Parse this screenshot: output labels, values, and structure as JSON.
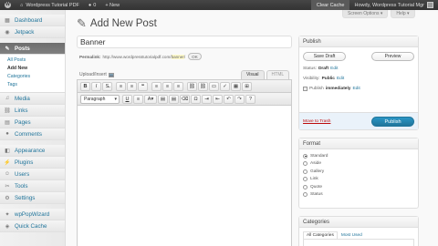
{
  "adminbar": {
    "site_name": "Wordpress Tutorial PDF",
    "comments_count": "0",
    "new_label": "+ New",
    "clear_cache": "Clear Cache",
    "howdy": "Howdy, Wordpress Tutorial Mgr"
  },
  "screen": {
    "options": "Screen Options ▾",
    "help": "Help ▾"
  },
  "menu": {
    "dashboard": "Dashboard",
    "jetpack": "Jetpack",
    "posts": "Posts",
    "posts_sub": [
      "All Posts",
      "Add New",
      "Categories",
      "Tags"
    ],
    "media": "Media",
    "links": "Links",
    "pages": "Pages",
    "comments": "Comments",
    "appearance": "Appearance",
    "plugins": "Plugins",
    "users": "Users",
    "tools": "Tools",
    "settings": "Settings",
    "wppopwizard": "wpPopWizard",
    "quick_cache": "Quick Cache"
  },
  "page": {
    "title": "Add New Post"
  },
  "post": {
    "title_value": "Banner",
    "permalink_label": "Permalink:",
    "permalink_base": "http://www.wordpresstutorialpdf.com/",
    "permalink_slug": "banner",
    "ok_label": "OK"
  },
  "editor": {
    "upload_insert": "Upload/Insert",
    "tab_visual": "Visual",
    "tab_html": "HTML",
    "format_select": "Paragraph",
    "row1": [
      "B",
      "I",
      "S̶",
      "≡",
      "≡",
      "❝",
      "≡",
      "≡",
      "≡",
      "⛓",
      "⛓",
      "▭",
      "✓",
      "▦",
      "⊞"
    ],
    "row2": [
      "U",
      "≡",
      "A",
      "▤",
      "▤",
      "⌫",
      "Ω",
      "⇥",
      "⇤",
      "↶",
      "↷",
      "?"
    ]
  },
  "publish": {
    "heading": "Publish",
    "save_draft": "Save Draft",
    "preview": "Preview",
    "status_label": "Status:",
    "status_value": "Draft",
    "visibility_label": "Visibility:",
    "visibility_value": "Public",
    "schedule_label": "Publish",
    "schedule_value": "immediately",
    "edit": "Edit",
    "trash": "Move to Trash",
    "publish": "Publish"
  },
  "format": {
    "heading": "Format",
    "options": [
      "Standard",
      "Aside",
      "Gallery",
      "Link",
      "Quote",
      "Status"
    ],
    "selected": "Standard"
  },
  "categories": {
    "heading": "Categories",
    "tab_all": "All Categories",
    "tab_used": "Most Used"
  },
  "colors": {
    "accent": "#21759b",
    "adminbar": "#464646",
    "trash": "#bc0b0b"
  }
}
